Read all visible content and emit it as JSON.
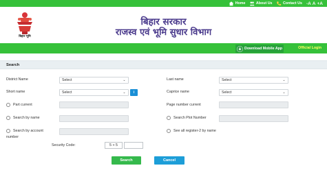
{
  "colors": {
    "green": "#36c13a",
    "blue": "#1d9ed8",
    "title": "#4a3a8c"
  },
  "topbar": {
    "links": [
      {
        "label": "Home",
        "icon": "home-icon"
      },
      {
        "label": "About Us",
        "icon": "people-icon"
      },
      {
        "label": "Contact Us",
        "icon": "phone-icon"
      }
    ],
    "access": [
      "-A",
      "A",
      "+A"
    ]
  },
  "header": {
    "title_line1": "बिहार सरकार",
    "title_line2": "राजस्व एवं भूमि सुधार विभाग",
    "emblem_caption": "बिहार भूमि"
  },
  "appbar": {
    "download_label": "Download Mobile App",
    "official_login": "Official Login"
  },
  "search": {
    "heading": "Search",
    "district_label": "District Name",
    "district_value": "Select",
    "lastname_label": "Last name",
    "lastname_value": "Select",
    "shortname_label": "Short name",
    "shortname_value": "Select",
    "info_button": "i",
    "caprice_label": "Caprice name",
    "caprice_value": "Select",
    "part_current_label": "Part current",
    "page_number_label": "Page number current",
    "search_by_name_label": "Search by name",
    "plot_number_label": "Search Plot Number",
    "account_label_line1": "Search by account",
    "account_label_line2": "number",
    "all_register_label": "See all register-2 by name",
    "security_label": "Security Code:",
    "captcha_text": "5 + 5",
    "search_button": "Search",
    "cancel_button": "Cancel"
  }
}
